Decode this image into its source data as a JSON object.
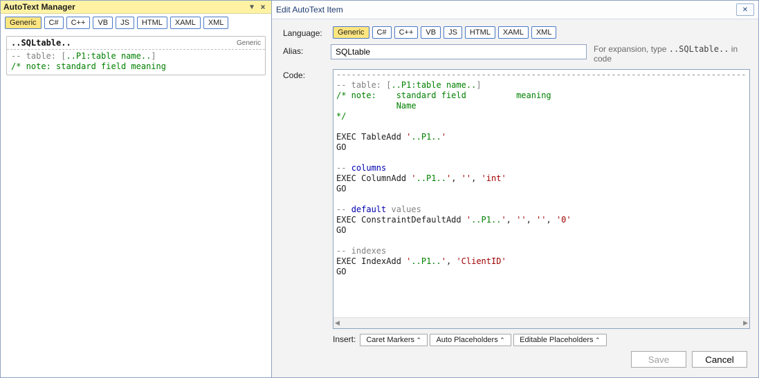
{
  "panel": {
    "title": "AutoText Manager",
    "languages": [
      "Generic",
      "C#",
      "C++",
      "VB",
      "JS",
      "HTML",
      "XAML",
      "XML"
    ],
    "selected_language": "Generic",
    "item": {
      "alias": "..SQLtable..",
      "tag": "Generic",
      "preview": {
        "line1_pre": "-- table: [",
        "line1_ph": "..P1:table name..",
        "line1_post": "]",
        "line2_a": "/* note:    ",
        "line2_b": "standard field",
        "line2_c": "          meaning"
      }
    }
  },
  "dialog": {
    "title": "Edit AutoText Item",
    "labels": {
      "language": "Language:",
      "alias": "Alias:",
      "code": "Code:",
      "insert": "Insert:"
    },
    "languages": [
      "Generic",
      "C#",
      "C++",
      "VB",
      "JS",
      "HTML",
      "XAML",
      "XML"
    ],
    "selected_language": "Generic",
    "alias_value": "SQLtable",
    "hint_prefix": "For expansion, type ",
    "hint_code": "..SQLtable..",
    "hint_suffix": " in code",
    "insert_buttons": [
      "Caret Markers",
      "Auto Placeholders",
      "Editable Placeholders"
    ],
    "save": "Save",
    "cancel": "Cancel",
    "code_tokens": [
      [
        {
          "c": "dash",
          "t": "----------------------------------------------------------------------------------"
        }
      ],
      [
        {
          "c": "c-gray",
          "t": "-- table: ["
        },
        {
          "c": "c-green",
          "t": "..P1:table name.."
        },
        {
          "c": "c-gray",
          "t": "]"
        }
      ],
      [
        {
          "c": "c-green",
          "t": "/* note:    standard field          meaning"
        }
      ],
      [
        {
          "c": "c-green",
          "t": "            Name"
        }
      ],
      [
        {
          "c": "c-green",
          "t": "*/"
        }
      ],
      [],
      [
        {
          "t": "EXEC TableAdd "
        },
        {
          "c": "c-red",
          "t": "'"
        },
        {
          "c": "c-green",
          "t": "..P1.."
        },
        {
          "c": "c-red",
          "t": "'"
        }
      ],
      [
        {
          "t": "GO"
        }
      ],
      [],
      [
        {
          "c": "c-gray",
          "t": "-- "
        },
        {
          "c": "c-blue",
          "t": "columns"
        }
      ],
      [
        {
          "t": "EXEC ColumnAdd "
        },
        {
          "c": "c-red",
          "t": "'"
        },
        {
          "c": "c-green",
          "t": "..P1.."
        },
        {
          "c": "c-red",
          "t": "'"
        },
        {
          "t": ", "
        },
        {
          "c": "c-red",
          "t": "''"
        },
        {
          "t": ", "
        },
        {
          "c": "c-red",
          "t": "'int'"
        }
      ],
      [
        {
          "t": "GO"
        }
      ],
      [],
      [
        {
          "c": "c-gray",
          "t": "-- "
        },
        {
          "c": "c-blue",
          "t": "default"
        },
        {
          "c": "c-gray",
          "t": " values"
        }
      ],
      [
        {
          "t": "EXEC ConstraintDefaultAdd "
        },
        {
          "c": "c-red",
          "t": "'"
        },
        {
          "c": "c-green",
          "t": "..P1.."
        },
        {
          "c": "c-red",
          "t": "'"
        },
        {
          "t": ", "
        },
        {
          "c": "c-red",
          "t": "''"
        },
        {
          "t": ", "
        },
        {
          "c": "c-red",
          "t": "''"
        },
        {
          "t": ", "
        },
        {
          "c": "c-red",
          "t": "'0'"
        }
      ],
      [
        {
          "t": "GO"
        }
      ],
      [],
      [
        {
          "c": "c-gray",
          "t": "-- indexes"
        }
      ],
      [
        {
          "t": "EXEC IndexAdd "
        },
        {
          "c": "c-red",
          "t": "'"
        },
        {
          "c": "c-green",
          "t": "..P1.."
        },
        {
          "c": "c-red",
          "t": "'"
        },
        {
          "t": ", "
        },
        {
          "c": "c-red",
          "t": "'ClientID'"
        }
      ],
      [
        {
          "t": "GO"
        }
      ]
    ]
  }
}
